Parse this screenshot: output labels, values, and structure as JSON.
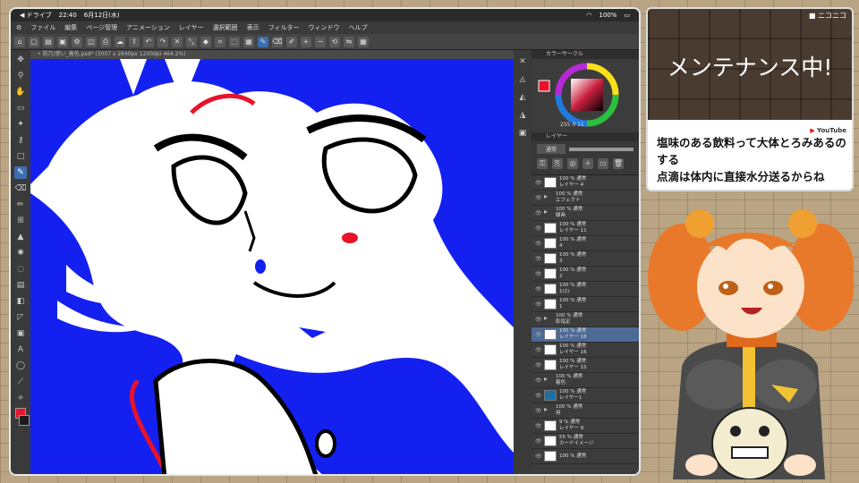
{
  "status_bar": {
    "back_label": "◀ ドライブ",
    "time": "22:40",
    "date": "6月12日(水)",
    "battery": "100%"
  },
  "menu": [
    "ファイル",
    "編集",
    "ページ管理",
    "アニメーション",
    "レイヤー",
    "選択範囲",
    "表示",
    "フィルター",
    "ウィンドウ",
    "ヘルプ"
  ],
  "canvas_tab": "• 前乃(使い_着色.psd* (3007 x 2640px 1200dpi 464.2%)",
  "color_panel": {
    "title": "カラーサークル",
    "values": "255 0 11",
    "main_color": "#e8132a"
  },
  "layer_panel": {
    "title": "レイヤー",
    "blend_mode": "通常",
    "layers": [
      {
        "opacity": "100 %",
        "mode": "通常",
        "name": "レイヤー 4",
        "thumb": "white",
        "selected": false
      },
      {
        "opacity": "100 %",
        "mode": "通常",
        "name": "エフェクト",
        "thumb": "folder",
        "selected": false
      },
      {
        "opacity": "100 %",
        "mode": "通常",
        "name": "線画",
        "thumb": "folder",
        "selected": false
      },
      {
        "opacity": "100 %",
        "mode": "通常",
        "name": "レイヤー 11",
        "thumb": "white",
        "selected": false
      },
      {
        "opacity": "100 %",
        "mode": "通常",
        "name": "4",
        "thumb": "white",
        "selected": false
      },
      {
        "opacity": "100 %",
        "mode": "通常",
        "name": "3",
        "thumb": "white",
        "selected": false
      },
      {
        "opacity": "100 %",
        "mode": "通常",
        "name": "2",
        "thumb": "white",
        "selected": false
      },
      {
        "opacity": "100 %",
        "mode": "通常",
        "name": "1(2)",
        "thumb": "white",
        "selected": false
      },
      {
        "opacity": "100 %",
        "mode": "通常",
        "name": "1",
        "thumb": "white",
        "selected": false
      },
      {
        "opacity": "100 %",
        "mode": "通常",
        "name": "影指定",
        "thumb": "folder",
        "selected": false
      },
      {
        "opacity": "100 %",
        "mode": "通常",
        "name": "レイヤー 18",
        "thumb": "white",
        "selected": true
      },
      {
        "opacity": "100 %",
        "mode": "通常",
        "name": "レイヤー 16",
        "thumb": "white",
        "selected": false
      },
      {
        "opacity": "100 %",
        "mode": "通常",
        "name": "レイヤー 15",
        "thumb": "white",
        "selected": false
      },
      {
        "opacity": "100 %",
        "mode": "通常",
        "name": "着色",
        "thumb": "folder",
        "selected": false
      },
      {
        "opacity": "100 %",
        "mode": "通常",
        "name": "レイヤー1",
        "thumb": "blue",
        "selected": false
      },
      {
        "opacity": "100 %",
        "mode": "通常",
        "name": "用",
        "thumb": "folder",
        "selected": false
      },
      {
        "opacity": "9 %",
        "mode": "通常",
        "name": "レイヤー 9",
        "thumb": "white",
        "selected": false
      },
      {
        "opacity": "55 %",
        "mode": "通常",
        "name": "カードイメージ",
        "thumb": "white",
        "selected": false
      },
      {
        "opacity": "100 %",
        "mode": "通常",
        "name": "",
        "thumb": "white",
        "selected": false
      }
    ]
  },
  "notice": {
    "logo": "■ ニコニコ",
    "title": "メンテナンス中!",
    "yt_badge": "YouTube",
    "chat_line1": "塩味のある飲料って大体とろみあるの",
    "chat_line2": "する",
    "chat_line3": "点滴は体内に直接水分送るからね"
  }
}
